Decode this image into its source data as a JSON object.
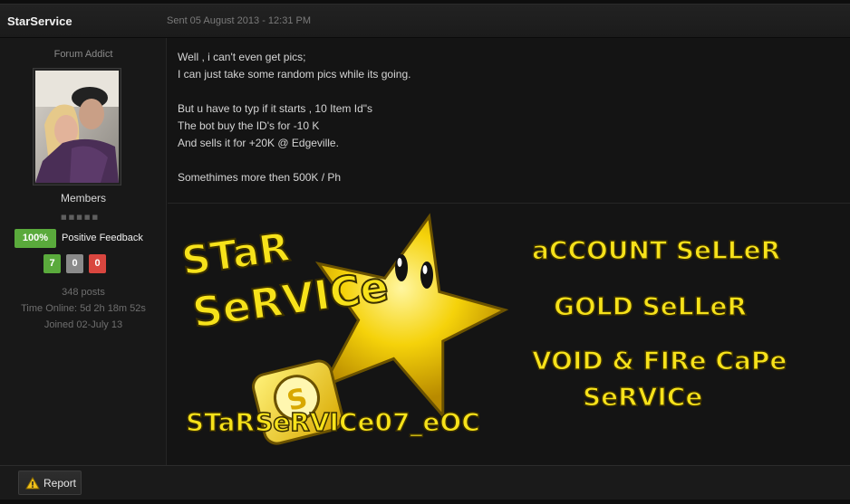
{
  "post": {
    "author": "StarService",
    "date": "Sent 05 August 2013 - 12:31 PM",
    "body_lines": [
      "Well , i can't even get pics;",
      "I can just take some random pics while its going.",
      "",
      "But  u have to typ if it starts , 10 Item Id\"s",
      "The bot buy the ID's for -10 K",
      "And sells it for +20K @ Edgeville.",
      "",
      "Somethimes more then 500K / Ph"
    ]
  },
  "author_panel": {
    "member_title": "Forum Addict",
    "group": "Members",
    "pips": "■■■■■",
    "feedback_percent": "100%",
    "feedback_label": "Positive Feedback",
    "rep_positive": "7",
    "rep_neutral": "0",
    "rep_negative": "0",
    "posts": "348 posts",
    "time_online": "Time Online: 5d 2h 18m 52s",
    "joined": "Joined 02-July 13"
  },
  "signature": {
    "brand_line1": "STaR",
    "brand_line2": "SeRVICe",
    "skype_name": "STaRSeRVICe07_eOC",
    "skype_letter": "S",
    "services": [
      "aCCOUNT SeLLeR",
      "GOLD SeLLeR",
      "VOID & FIRe CaPe",
      "SeRVICe"
    ],
    "accent_color": "#f7e21a",
    "outline_color": "#3a2f00"
  },
  "footer": {
    "report_label": "Report",
    "report_icon": "warning-icon"
  }
}
